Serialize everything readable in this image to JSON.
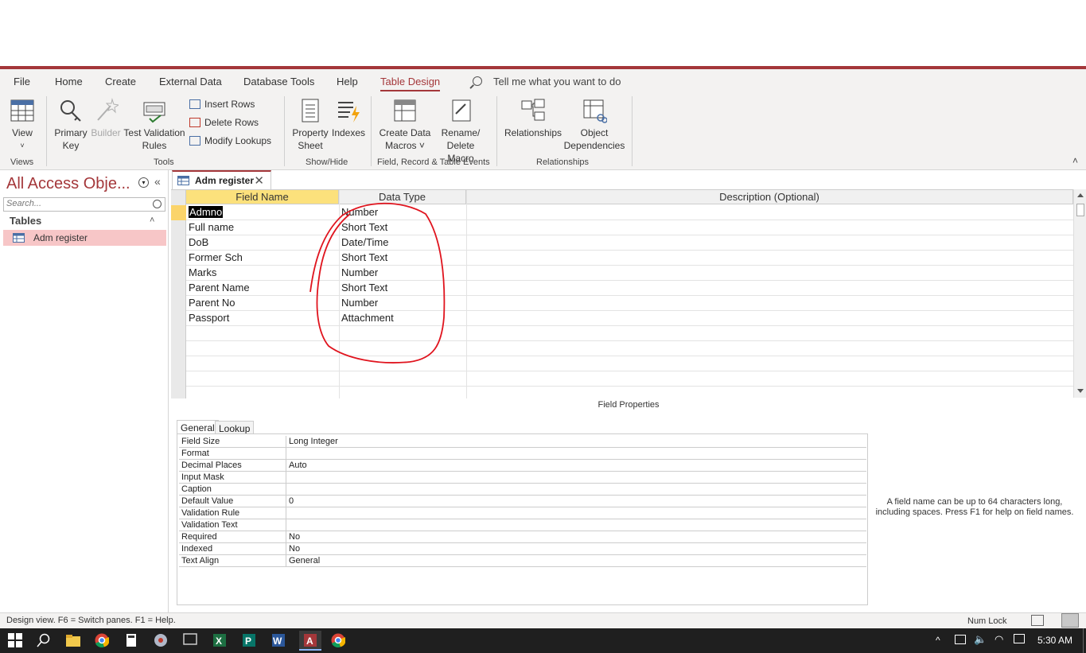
{
  "menu": [
    "File",
    "Home",
    "Create",
    "External Data",
    "Database Tools",
    "Help",
    "Table Design"
  ],
  "tell_me": "Tell me what you want to do",
  "ribbon": {
    "view": "View",
    "primary_key": [
      "Primary",
      "Key"
    ],
    "builder": "Builder",
    "test_validation": [
      "Test Validation",
      "Rules"
    ],
    "insert_rows": "Insert Rows",
    "delete_rows": "Delete Rows",
    "modify_lookups": "Modify Lookups",
    "property_sheet": [
      "Property",
      "Sheet"
    ],
    "indexes": "Indexes",
    "create_data_macros": [
      "Create Data",
      "Macros ˅"
    ],
    "rename_delete_macro": [
      "Rename/",
      "Delete Macro"
    ],
    "relationships": "Relationships",
    "object_dependencies": [
      "Object",
      "Dependencies"
    ],
    "groups": [
      "Views",
      "Tools",
      "Show/Hide",
      "Field, Record & Table Events",
      "Relationships"
    ]
  },
  "nav": {
    "title": "All Access Obje...",
    "search_placeholder": "Search...",
    "section": "Tables",
    "item": "Adm register"
  },
  "doc_tab": "Adm register",
  "grid": {
    "headers": [
      "Field Name",
      "Data Type",
      "Description (Optional)"
    ],
    "rows": [
      {
        "name": "Admno",
        "type": "Number"
      },
      {
        "name": "Full name",
        "type": "Short Text"
      },
      {
        "name": "DoB",
        "type": "Date/Time"
      },
      {
        "name": "Former Sch",
        "type": "Short Text"
      },
      {
        "name": "Marks",
        "type": "Number"
      },
      {
        "name": "Parent Name",
        "type": "Short Text"
      },
      {
        "name": "Parent No",
        "type": "Number"
      },
      {
        "name": "Passport",
        "type": "Attachment"
      }
    ]
  },
  "field_properties": {
    "title": "Field Properties",
    "tabs": [
      "General",
      "Lookup"
    ],
    "rows": [
      {
        "name": "Field Size",
        "value": "Long Integer"
      },
      {
        "name": "Format",
        "value": ""
      },
      {
        "name": "Decimal Places",
        "value": "Auto"
      },
      {
        "name": "Input Mask",
        "value": ""
      },
      {
        "name": "Caption",
        "value": ""
      },
      {
        "name": "Default Value",
        "value": "0"
      },
      {
        "name": "Validation Rule",
        "value": ""
      },
      {
        "name": "Validation Text",
        "value": ""
      },
      {
        "name": "Required",
        "value": "No"
      },
      {
        "name": "Indexed",
        "value": "No"
      },
      {
        "name": "Text Align",
        "value": "General"
      }
    ],
    "help": "A field name can be up to 64 characters long, including spaces. Press F1 for help on field names."
  },
  "status": {
    "left": "Design view.  F6 = Switch panes.  F1 = Help.",
    "numlock": "Num Lock"
  },
  "taskbar": {
    "clock": "5:30 AM"
  },
  "colors": {
    "accent": "#a4373a",
    "selected_header": "#fce17c",
    "nav_selected": "#f7c6c7",
    "annotation": "#e0141e"
  }
}
